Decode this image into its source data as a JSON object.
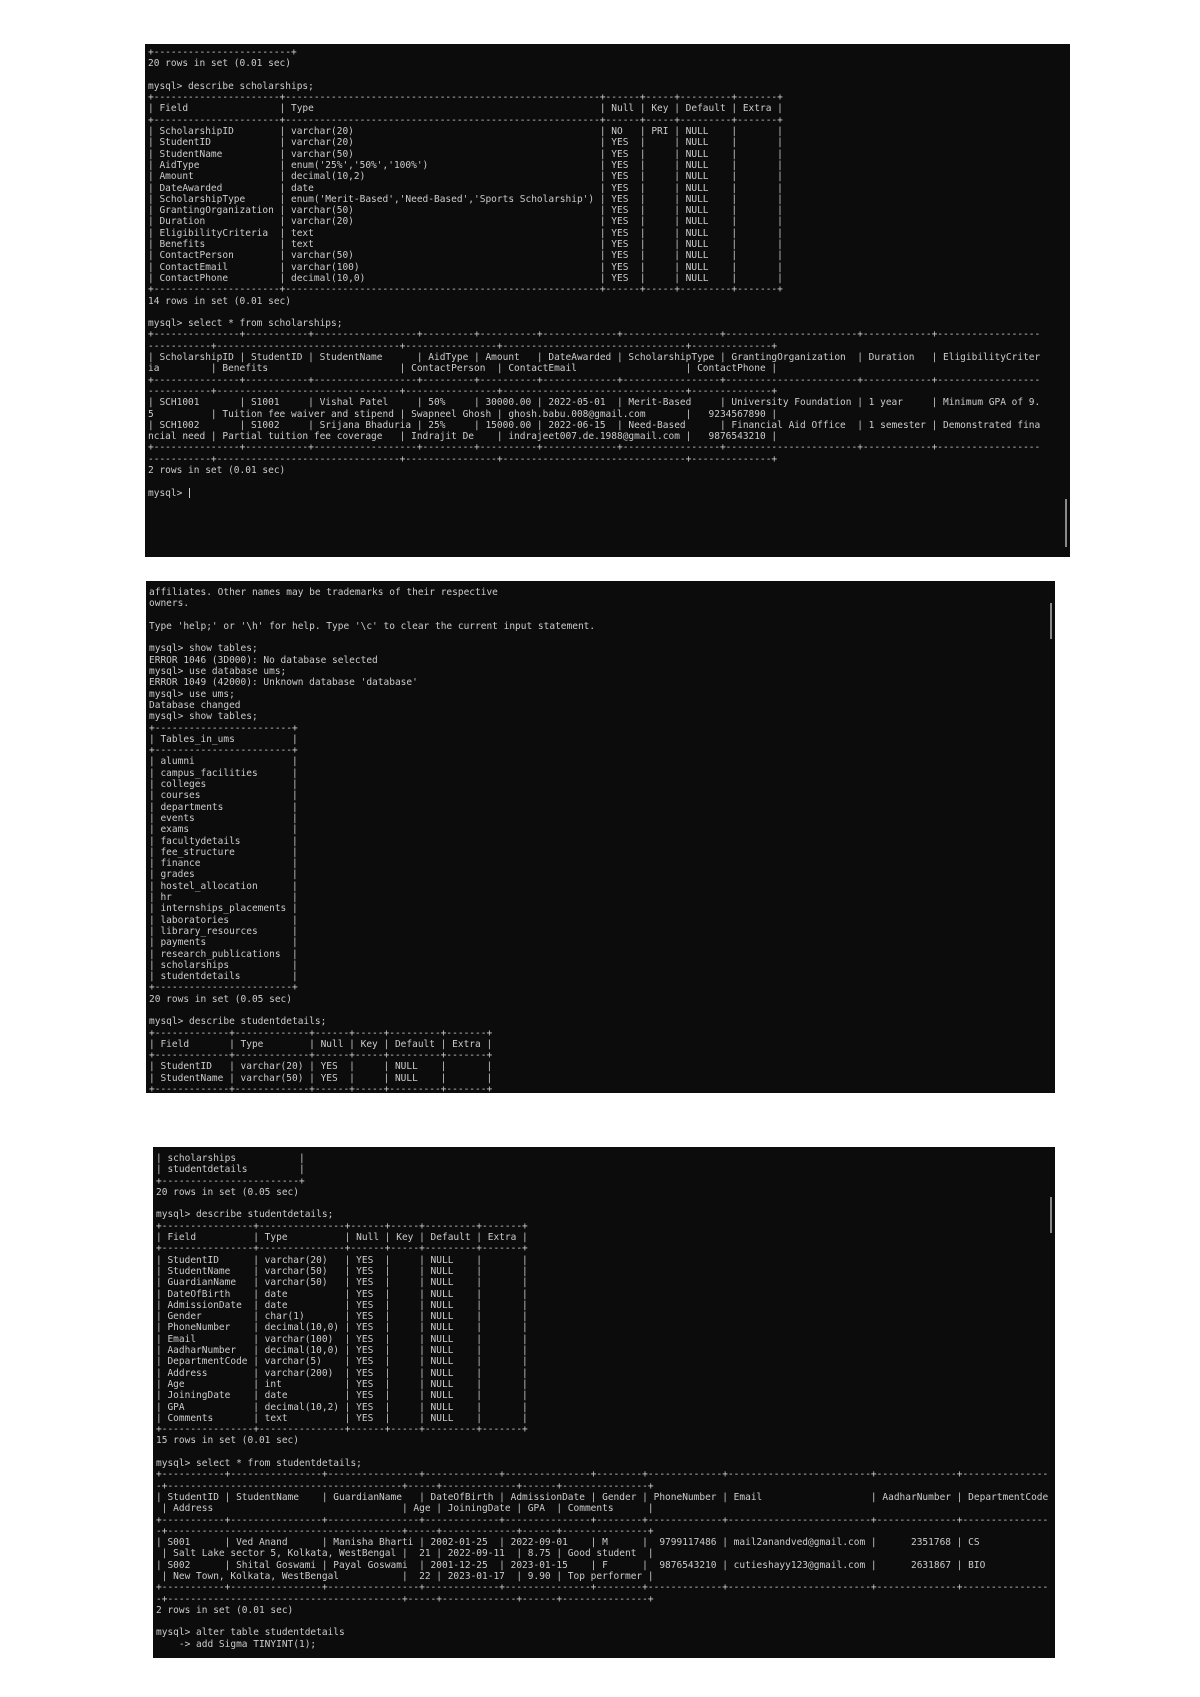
{
  "colors": {
    "background": "#0c0c0c",
    "text": "#cccccc"
  },
  "panels": [
    {
      "cursor": true,
      "blocks": [
        {
          "type": "text",
          "lines": [
            "+------------------------+",
            "20 rows in set (0.01 sec)",
            "",
            "mysql> describe scholarships;"
          ]
        },
        {
          "type": "table",
          "columns": [
            "Field",
            "Type",
            "Null",
            "Key",
            "Default",
            "Extra"
          ],
          "rows": [
            [
              "ScholarshipID",
              "varchar(20)",
              "NO",
              "PRI",
              "NULL",
              ""
            ],
            [
              "StudentID",
              "varchar(20)",
              "YES",
              "",
              "NULL",
              ""
            ],
            [
              "StudentName",
              "varchar(50)",
              "YES",
              "",
              "NULL",
              ""
            ],
            [
              "AidType",
              "enum('25%','50%','100%')",
              "YES",
              "",
              "NULL",
              ""
            ],
            [
              "Amount",
              "decimal(10,2)",
              "YES",
              "",
              "NULL",
              ""
            ],
            [
              "DateAwarded",
              "date",
              "YES",
              "",
              "NULL",
              ""
            ],
            [
              "ScholarshipType",
              "enum('Merit-Based','Need-Based','Sports Scholarship')",
              "YES",
              "",
              "NULL",
              ""
            ],
            [
              "GrantingOrganization",
              "varchar(50)",
              "YES",
              "",
              "NULL",
              ""
            ],
            [
              "Duration",
              "varchar(20)",
              "YES",
              "",
              "NULL",
              ""
            ],
            [
              "EligibilityCriteria",
              "text",
              "YES",
              "",
              "NULL",
              ""
            ],
            [
              "Benefits",
              "text",
              "YES",
              "",
              "NULL",
              ""
            ],
            [
              "ContactPerson",
              "varchar(50)",
              "YES",
              "",
              "NULL",
              ""
            ],
            [
              "ContactEmail",
              "varchar(100)",
              "YES",
              "",
              "NULL",
              ""
            ],
            [
              "ContactPhone",
              "decimal(10,0)",
              "YES",
              "",
              "NULL",
              ""
            ]
          ]
        },
        {
          "type": "text",
          "lines": [
            "14 rows in set (0.01 sec)",
            "",
            "mysql> select * from scholarships;"
          ]
        },
        {
          "type": "table",
          "columns": [
            "ScholarshipID",
            "StudentID",
            "StudentName",
            "AidType",
            "Amount",
            "DateAwarded",
            "ScholarshipType",
            "GrantingOrganization",
            "Duration",
            "EligibilityCriteria",
            "Benefits",
            "ContactPerson",
            "ContactEmail",
            "ContactPhone"
          ],
          "rows": [
            [
              "SCH1001",
              "S1001",
              "Vishal Patel",
              "50%",
              "30000.00",
              "2022-05-01",
              "Merit-Based",
              "University Foundation",
              "1 year",
              "Minimum GPA of 9.5",
              "Tuition fee waiver and stipend",
              "Swapneel Ghosh",
              "ghosh.babu.008@gmail.com",
              "9234567890"
            ],
            [
              "SCH1002",
              "S1002",
              "Srijana Bhaduria",
              "25%",
              "15000.00",
              "2022-06-15",
              "Need-Based",
              "Financial Aid Office",
              "1 semester",
              "Demonstrated financial need",
              "Partial tuition fee coverage",
              "Indrajit De",
              "indrajeet007.de.1988@gmail.com",
              "9876543210"
            ]
          ]
        },
        {
          "type": "text",
          "lines": [
            "2 rows in set (0.01 sec)",
            "",
            "mysql> "
          ]
        }
      ]
    },
    {
      "cursor": false,
      "blocks": [
        {
          "type": "text",
          "lines": [
            "affiliates. Other names may be trademarks of their respective",
            "owners.",
            "",
            "Type 'help;' or '\\h' for help. Type '\\c' to clear the current input statement.",
            "",
            "mysql> show tables;",
            "ERROR 1046 (3D000): No database selected",
            "mysql> use database ums;",
            "ERROR 1049 (42000): Unknown database 'database'",
            "mysql> use ums;",
            "Database changed",
            "mysql> show tables;"
          ]
        },
        {
          "type": "table",
          "columns": [
            "Tables_in_ums"
          ],
          "rows": [
            [
              "alumni"
            ],
            [
              "campus_facilities"
            ],
            [
              "colleges"
            ],
            [
              "courses"
            ],
            [
              "departments"
            ],
            [
              "events"
            ],
            [
              "exams"
            ],
            [
              "facultydetails"
            ],
            [
              "fee_structure"
            ],
            [
              "finance"
            ],
            [
              "grades"
            ],
            [
              "hostel_allocation"
            ],
            [
              "hr"
            ],
            [
              "internships_placements"
            ],
            [
              "laboratories"
            ],
            [
              "library_resources"
            ],
            [
              "payments"
            ],
            [
              "research_publications"
            ],
            [
              "scholarships"
            ],
            [
              "studentdetails"
            ]
          ]
        },
        {
          "type": "text",
          "lines": [
            "20 rows in set (0.05 sec)",
            "",
            "mysql> describe studentdetails;"
          ]
        },
        {
          "type": "table",
          "columns": [
            "Field",
            "Type",
            "Null",
            "Key",
            "Default",
            "Extra"
          ],
          "widths_from": "studentdetails",
          "rows": [
            [
              "StudentID",
              "varchar(20)",
              "YES",
              "",
              "NULL",
              ""
            ],
            [
              "StudentName",
              "varchar(50)",
              "YES",
              "",
              "NULL",
              ""
            ]
          ]
        }
      ]
    },
    {
      "cursor": false,
      "blocks": [
        {
          "type": "text",
          "lines": [
            "| scholarships           |",
            "| studentdetails         |",
            "+------------------------+",
            "20 rows in set (0.05 sec)",
            "",
            "mysql> describe studentdetails;"
          ]
        },
        {
          "type": "table",
          "columns": [
            "Field",
            "Type",
            "Null",
            "Key",
            "Default",
            "Extra"
          ],
          "rows": [
            [
              "StudentID",
              "varchar(20)",
              "YES",
              "",
              "NULL",
              ""
            ],
            [
              "StudentName",
              "varchar(50)",
              "YES",
              "",
              "NULL",
              ""
            ],
            [
              "GuardianName",
              "varchar(50)",
              "YES",
              "",
              "NULL",
              ""
            ],
            [
              "DateOfBirth",
              "date",
              "YES",
              "",
              "NULL",
              ""
            ],
            [
              "AdmissionDate",
              "date",
              "YES",
              "",
              "NULL",
              ""
            ],
            [
              "Gender",
              "char(1)",
              "YES",
              "",
              "NULL",
              ""
            ],
            [
              "PhoneNumber",
              "decimal(10,0)",
              "YES",
              "",
              "NULL",
              ""
            ],
            [
              "Email",
              "varchar(100)",
              "YES",
              "",
              "NULL",
              ""
            ],
            [
              "AadharNumber",
              "decimal(10,0)",
              "YES",
              "",
              "NULL",
              ""
            ],
            [
              "DepartmentCode",
              "varchar(5)",
              "YES",
              "",
              "NULL",
              ""
            ],
            [
              "Address",
              "varchar(200)",
              "YES",
              "",
              "NULL",
              ""
            ],
            [
              "Age",
              "int",
              "YES",
              "",
              "NULL",
              ""
            ],
            [
              "JoiningDate",
              "date",
              "YES",
              "",
              "NULL",
              ""
            ],
            [
              "GPA",
              "decimal(10,2)",
              "YES",
              "",
              "NULL",
              ""
            ],
            [
              "Comments",
              "text",
              "YES",
              "",
              "NULL",
              ""
            ]
          ]
        },
        {
          "type": "text",
          "lines": [
            "15 rows in set (0.01 sec)",
            "",
            "mysql> select * from studentdetails;"
          ]
        },
        {
          "type": "table",
          "columns": [
            "StudentID",
            "StudentName",
            "GuardianName",
            "DateOfBirth",
            "AdmissionDate",
            "Gender",
            "PhoneNumber",
            "Email",
            "AadharNumber",
            "DepartmentCode",
            "Address",
            "Age",
            "JoiningDate",
            "GPA",
            "Comments"
          ],
          "rows": [
            [
              "S001",
              "Ved Anand",
              "Manisha Bharti",
              "2002-01-25",
              "2022-09-01",
              "M",
              "9799117486",
              "mail2anandved@gmail.com",
              "2351768",
              "CS",
              "Salt Lake sector 5, Kolkata, WestBengal",
              "21",
              "2022-09-11",
              "8.75",
              "Good student"
            ],
            [
              "S002",
              "Shital Goswami",
              "Payal Goswami",
              "2001-12-25",
              "2023-01-15",
              "F",
              "9876543210",
              "cutieshayy123@gmail.com",
              "2631867",
              "BIO",
              "New Town, Kolkata, WestBengal",
              "22",
              "2023-01-17",
              "9.90",
              "Top performer"
            ]
          ]
        },
        {
          "type": "text",
          "lines": [
            "2 rows in set (0.01 sec)",
            "",
            "mysql> alter table studentdetails",
            "    -> add Sigma TINYINT(1);"
          ]
        }
      ]
    }
  ]
}
